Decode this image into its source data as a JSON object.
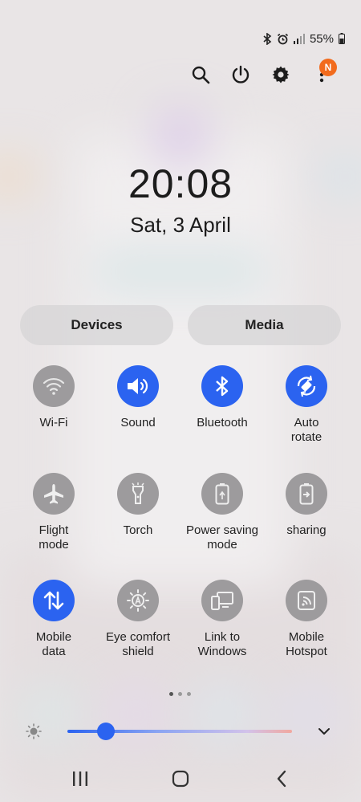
{
  "status_bar": {
    "battery": "55%"
  },
  "clock": {
    "time": "20:08",
    "date": "Sat, 3 April"
  },
  "notification_badge": "N",
  "panels": {
    "devices": "Devices",
    "media": "Media"
  },
  "tiles": [
    {
      "label": "Wi-Fi",
      "state": "off",
      "icon": "wifi-icon"
    },
    {
      "label": "Sound",
      "state": "on",
      "icon": "speaker-icon"
    },
    {
      "label": "Bluetooth",
      "state": "on",
      "icon": "bluetooth-icon"
    },
    {
      "label": "Auto\nrotate",
      "state": "on",
      "icon": "auto-rotate-icon"
    },
    {
      "label": "Flight\nmode",
      "state": "off",
      "icon": "airplane-icon"
    },
    {
      "label": "Torch",
      "state": "off",
      "icon": "torch-icon"
    },
    {
      "label": "Power saving\nmode",
      "state": "off",
      "icon": "power-saving-icon"
    },
    {
      "label": "sharing",
      "state": "off",
      "icon": "battery-share-icon"
    },
    {
      "label": "Mobile\ndata",
      "state": "on",
      "icon": "mobile-data-icon"
    },
    {
      "label": "Eye comfort\nshield",
      "state": "off",
      "icon": "eye-comfort-icon"
    },
    {
      "label": "Link to\nWindows",
      "state": "off",
      "icon": "link-windows-icon"
    },
    {
      "label": "Mobile\nHotspot",
      "state": "off",
      "icon": "hotspot-icon"
    }
  ],
  "brightness": {
    "level": 0.17
  },
  "colors": {
    "accent": "#2b63f0",
    "tile_off": "#9d9b9d",
    "badge": "#f26b1d"
  }
}
